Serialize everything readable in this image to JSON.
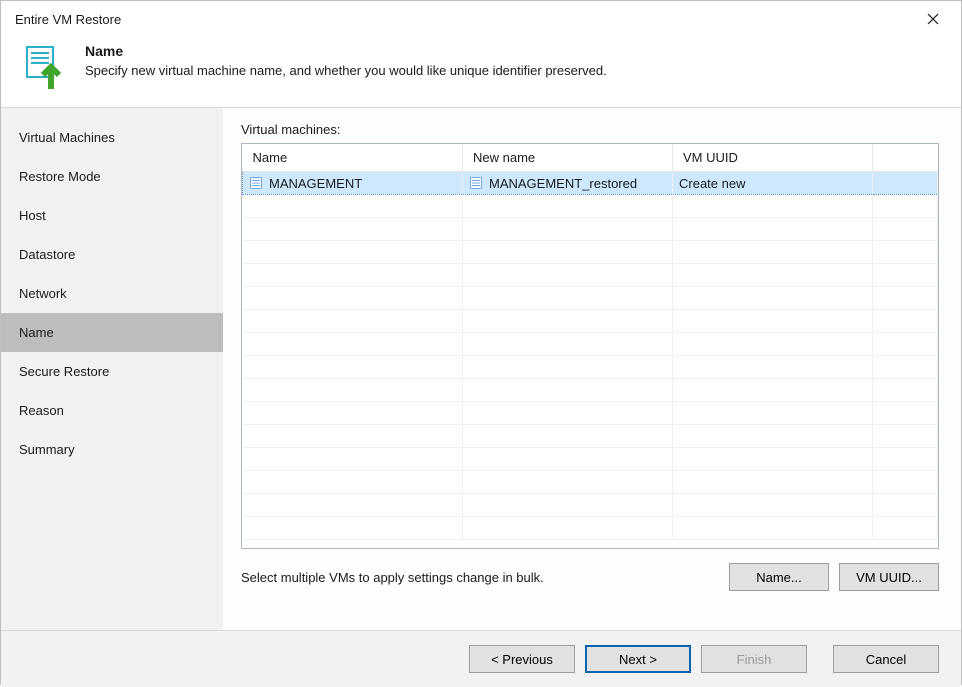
{
  "window": {
    "title": "Entire VM Restore"
  },
  "header": {
    "step_title": "Name",
    "step_desc": "Specify new virtual machine name, and whether you would like unique identifier preserved."
  },
  "sidebar": {
    "items": [
      {
        "label": "Virtual Machines",
        "active": false
      },
      {
        "label": "Restore Mode",
        "active": false
      },
      {
        "label": "Host",
        "active": false
      },
      {
        "label": "Datastore",
        "active": false
      },
      {
        "label": "Network",
        "active": false
      },
      {
        "label": "Name",
        "active": true
      },
      {
        "label": "Secure Restore",
        "active": false
      },
      {
        "label": "Reason",
        "active": false
      },
      {
        "label": "Summary",
        "active": false
      }
    ]
  },
  "main": {
    "list_label": "Virtual machines:",
    "columns": {
      "name": "Name",
      "new_name": "New name",
      "uuid": "VM UUID"
    },
    "rows": [
      {
        "name": "MANAGEMENT",
        "new_name": "MANAGEMENT_restored",
        "uuid": "Create new",
        "selected": true
      }
    ],
    "hint": "Select multiple VMs to apply settings change in bulk.",
    "buttons": {
      "name": "Name...",
      "uuid": "VM UUID..."
    }
  },
  "footer": {
    "previous": "< Previous",
    "next": "Next >",
    "finish": "Finish",
    "cancel": "Cancel"
  }
}
